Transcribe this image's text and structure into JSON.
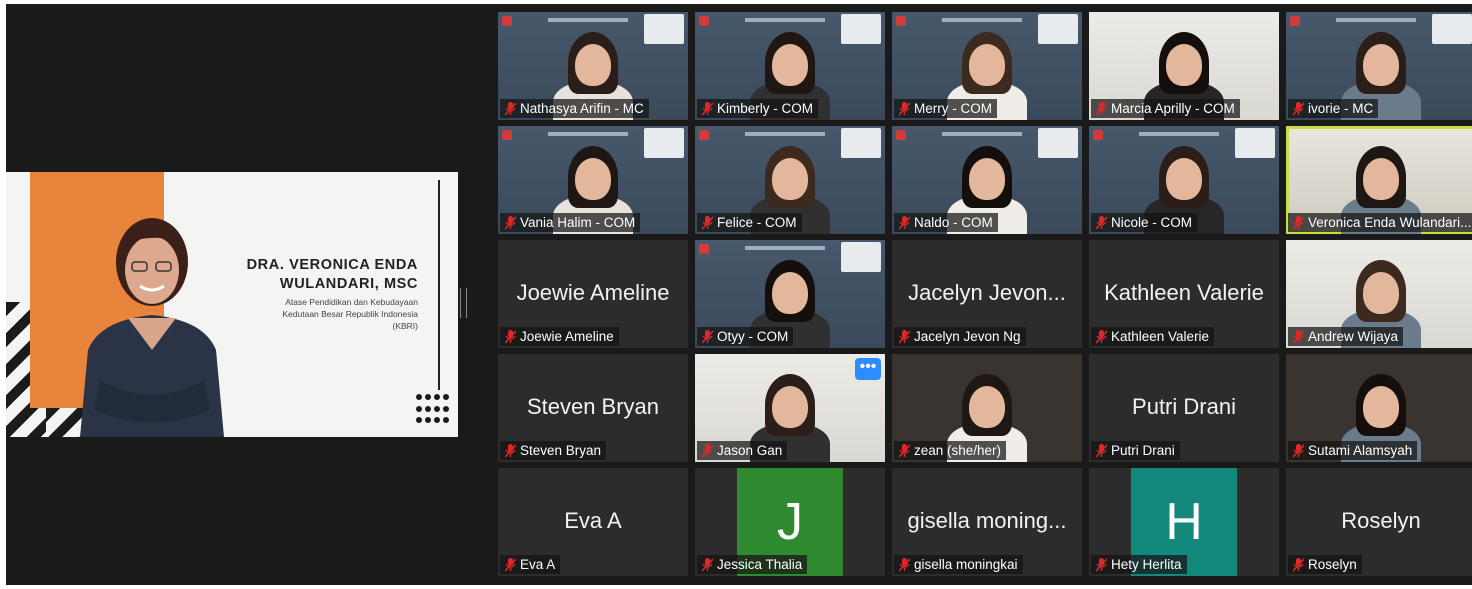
{
  "shared_screen": {
    "speaker_name": "DRA. VERONICA ENDA\nWULANDARI, MSC",
    "speaker_role": "Atase Pendidikan dan Kebudayaan\nKedutaan Besar Republik Indonesia\n(KBRI)"
  },
  "colors": {
    "orange": "#e8843b",
    "active_border": "#c9dd4a",
    "avatar_green": "#2f8a2f",
    "avatar_teal": "#12897a",
    "more_button": "#2d8cff"
  },
  "participants": [
    {
      "label": "Nathasya Arifin - MC",
      "type": "video",
      "bg": "slide"
    },
    {
      "label": "Kimberly - COM",
      "type": "video",
      "bg": "slide"
    },
    {
      "label": "Merry - COM",
      "type": "video",
      "bg": "slide"
    },
    {
      "label": "Marcia Aprilly - COM",
      "type": "video",
      "bg": "white"
    },
    {
      "label": "ivorie - MC",
      "type": "video",
      "bg": "slide"
    },
    {
      "label": "Vania Halim - COM",
      "type": "video",
      "bg": "slide"
    },
    {
      "label": "Felice - COM",
      "type": "video",
      "bg": "slide"
    },
    {
      "label": "Naldo - COM",
      "type": "video",
      "bg": "slide"
    },
    {
      "label": "Nicole - COM",
      "type": "video",
      "bg": "slide"
    },
    {
      "label": "Veronica Enda Wulandari...",
      "type": "video",
      "bg": "room",
      "active": true
    },
    {
      "label": "Joewie Ameline",
      "display": "Joewie Ameline",
      "type": "name"
    },
    {
      "label": "Otyy - COM",
      "type": "video",
      "bg": "slide"
    },
    {
      "label": "Jacelyn Jevon Ng",
      "display": "Jacelyn Jevon...",
      "type": "name"
    },
    {
      "label": "Kathleen Valerie",
      "display": "Kathleen Valerie",
      "type": "name"
    },
    {
      "label": "Andrew Wijaya",
      "type": "video",
      "bg": "white"
    },
    {
      "label": "Steven Bryan",
      "display": "Steven Bryan",
      "type": "name"
    },
    {
      "label": "Jason Gan",
      "type": "video",
      "bg": "white",
      "more": "•••"
    },
    {
      "label": "zean  (she/her)",
      "type": "video",
      "bg": "dark"
    },
    {
      "label": "Putri Drani",
      "display": "Putri Drani",
      "type": "name"
    },
    {
      "label": "Sutami Alamsyah",
      "type": "video",
      "bg": "dark"
    },
    {
      "label": "Eva A",
      "display": "Eva A",
      "type": "name"
    },
    {
      "label": "Jessica Thalia",
      "type": "avatar",
      "letter": "J",
      "color": "#2f8a2f"
    },
    {
      "label": "gisella moningkai",
      "display": "gisella moning...",
      "type": "name"
    },
    {
      "label": "Hety Herlita",
      "type": "avatar",
      "letter": "H",
      "color": "#12897a"
    },
    {
      "label": "Roselyn",
      "display": "Roselyn",
      "type": "name"
    }
  ]
}
